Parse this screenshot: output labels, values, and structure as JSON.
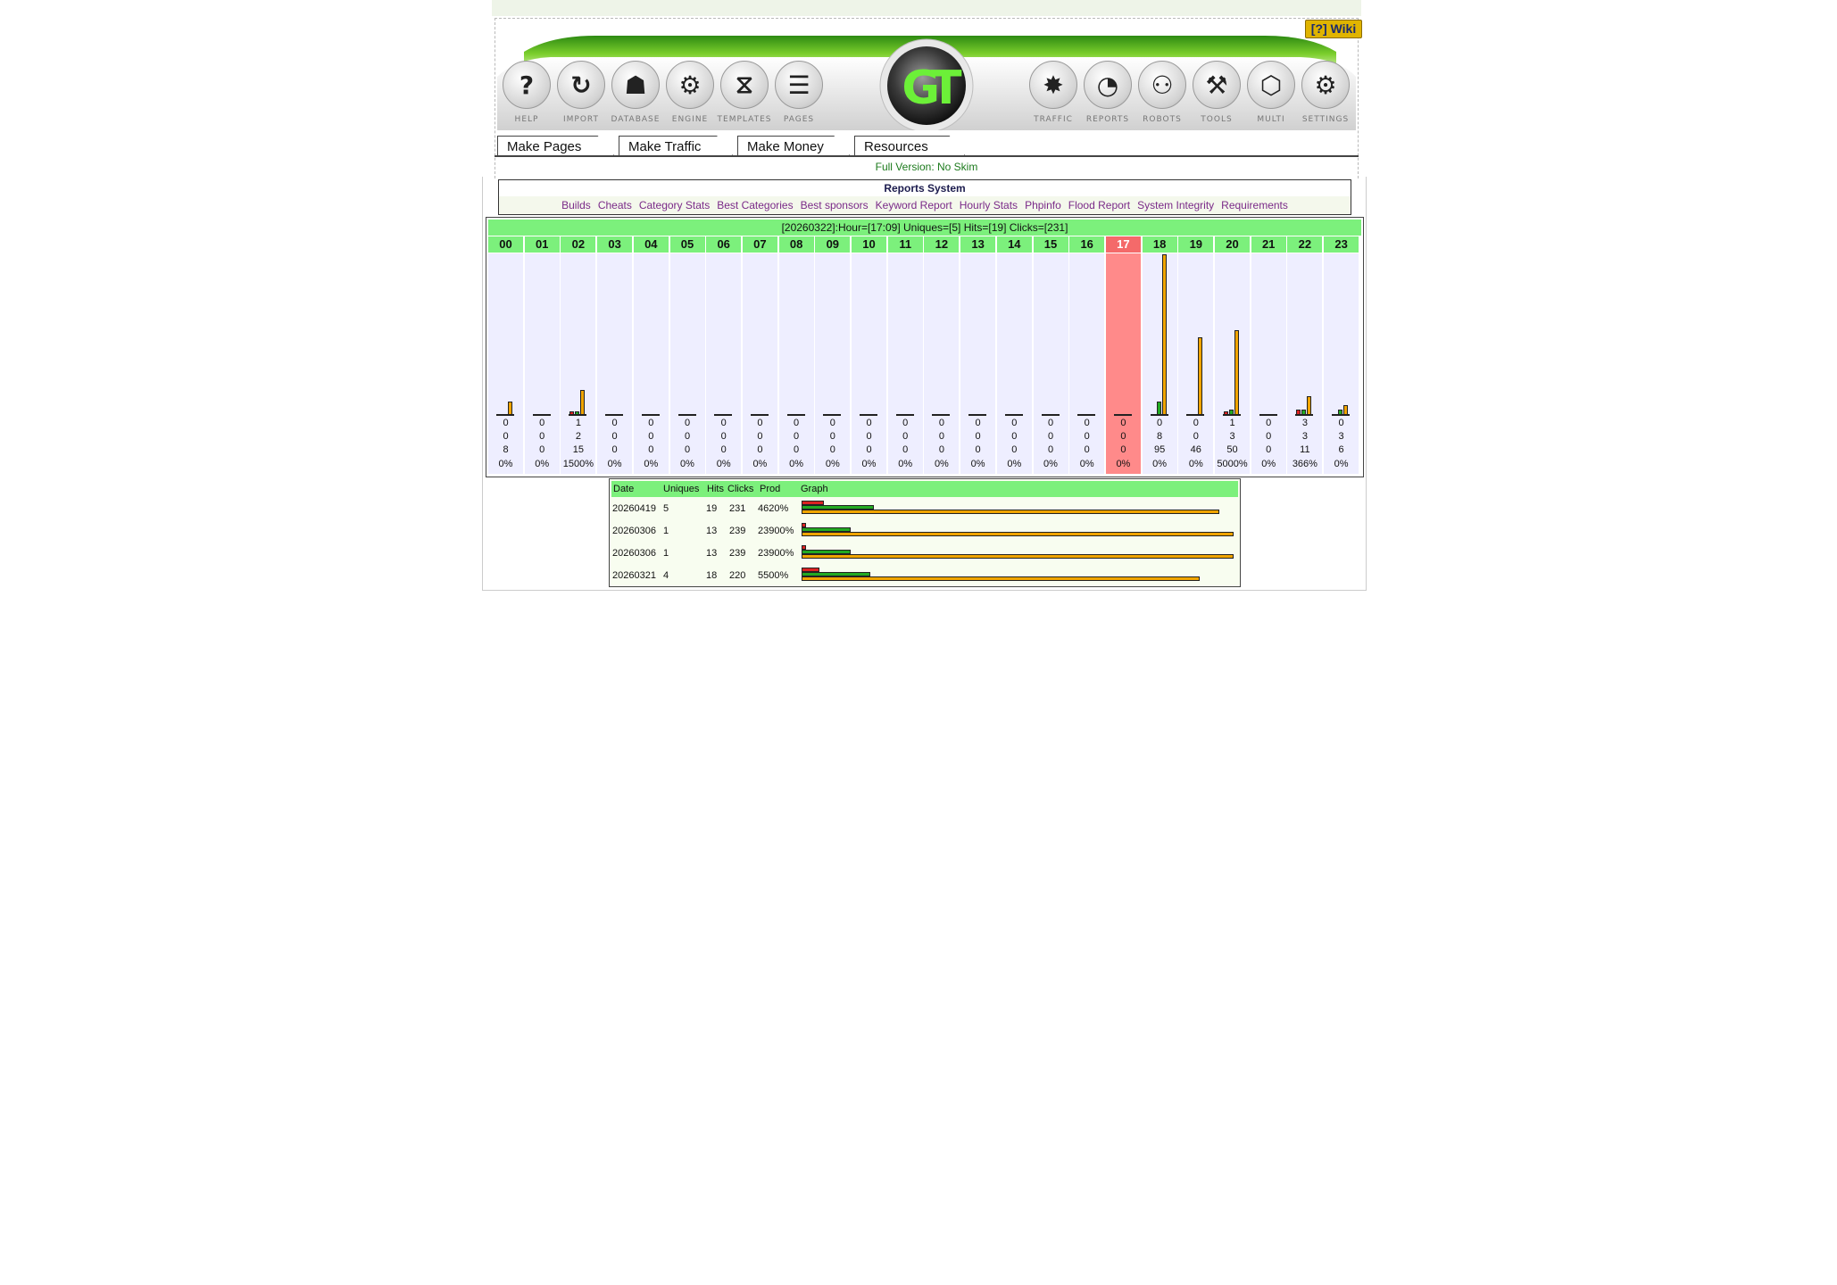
{
  "header": {
    "wiki_label": "[?] Wiki",
    "left_icons": [
      {
        "label": "HELP",
        "icon": "help-icon"
      },
      {
        "label": "IMPORT",
        "icon": "import-icon"
      },
      {
        "label": "DATABASE",
        "icon": "database-icon"
      },
      {
        "label": "ENGINE",
        "icon": "engine-icon"
      },
      {
        "label": "TEMPLATES",
        "icon": "templates-icon"
      },
      {
        "label": "PAGES",
        "icon": "pages-icon"
      }
    ],
    "right_icons": [
      {
        "label": "TRAFFIC",
        "icon": "traffic-icon"
      },
      {
        "label": "REPORTS",
        "icon": "reports-icon"
      },
      {
        "label": "ROBOTS",
        "icon": "robots-icon"
      },
      {
        "label": "TOOLS",
        "icon": "tools-icon"
      },
      {
        "label": "MULTI",
        "icon": "multi-icon"
      },
      {
        "label": "SETTINGS",
        "icon": "settings-icon"
      }
    ],
    "logo_text": "GT"
  },
  "tabs": [
    "Make Pages",
    "Make Traffic",
    "Make Money",
    "Resources"
  ],
  "version_text": "Full Version: No Skim",
  "reports": {
    "title": "Reports System",
    "links": [
      "Builds",
      "Cheats",
      "Category Stats",
      "Best Categories",
      "Best sponsors",
      "Keyword Report",
      "Hourly Stats",
      "Phpinfo",
      "Flood Report",
      "System Integrity",
      "Requirements"
    ]
  },
  "hourly": {
    "header": "[20260322]:Hour=[17:09] Uniques=[5] Hits=[19] Clicks=[231]",
    "active_hour": "17",
    "colors": {
      "uniques": "#dd2222",
      "hits": "#22aa22",
      "clicks": "#f0a400"
    },
    "hours": [
      {
        "hour": "00",
        "u": 0,
        "h": 0,
        "c": 8,
        "pct": "0%"
      },
      {
        "hour": "01",
        "u": 0,
        "h": 0,
        "c": 0,
        "pct": "0%"
      },
      {
        "hour": "02",
        "u": 1,
        "h": 2,
        "c": 15,
        "pct": "1500%"
      },
      {
        "hour": "03",
        "u": 0,
        "h": 0,
        "c": 0,
        "pct": "0%"
      },
      {
        "hour": "04",
        "u": 0,
        "h": 0,
        "c": 0,
        "pct": "0%"
      },
      {
        "hour": "05",
        "u": 0,
        "h": 0,
        "c": 0,
        "pct": "0%"
      },
      {
        "hour": "06",
        "u": 0,
        "h": 0,
        "c": 0,
        "pct": "0%"
      },
      {
        "hour": "07",
        "u": 0,
        "h": 0,
        "c": 0,
        "pct": "0%"
      },
      {
        "hour": "08",
        "u": 0,
        "h": 0,
        "c": 0,
        "pct": "0%"
      },
      {
        "hour": "09",
        "u": 0,
        "h": 0,
        "c": 0,
        "pct": "0%"
      },
      {
        "hour": "10",
        "u": 0,
        "h": 0,
        "c": 0,
        "pct": "0%"
      },
      {
        "hour": "11",
        "u": 0,
        "h": 0,
        "c": 0,
        "pct": "0%"
      },
      {
        "hour": "12",
        "u": 0,
        "h": 0,
        "c": 0,
        "pct": "0%"
      },
      {
        "hour": "13",
        "u": 0,
        "h": 0,
        "c": 0,
        "pct": "0%"
      },
      {
        "hour": "14",
        "u": 0,
        "h": 0,
        "c": 0,
        "pct": "0%"
      },
      {
        "hour": "15",
        "u": 0,
        "h": 0,
        "c": 0,
        "pct": "0%"
      },
      {
        "hour": "16",
        "u": 0,
        "h": 0,
        "c": 0,
        "pct": "0%"
      },
      {
        "hour": "17",
        "u": 0,
        "h": 0,
        "c": 0,
        "pct": "0%"
      },
      {
        "hour": "18",
        "u": 0,
        "h": 8,
        "c": 95,
        "pct": "0%"
      },
      {
        "hour": "19",
        "u": 0,
        "h": 0,
        "c": 46,
        "pct": "0%"
      },
      {
        "hour": "20",
        "u": 1,
        "h": 3,
        "c": 50,
        "pct": "5000%"
      },
      {
        "hour": "21",
        "u": 0,
        "h": 0,
        "c": 0,
        "pct": "0%"
      },
      {
        "hour": "22",
        "u": 3,
        "h": 3,
        "c": 11,
        "pct": "366%"
      },
      {
        "hour": "23",
        "u": 0,
        "h": 3,
        "c": 6,
        "pct": "0%"
      }
    ]
  },
  "daily": {
    "headers": [
      "Date",
      "Uniques",
      "Hits",
      "Clicks",
      "Prod",
      "Graph"
    ],
    "rows": [
      {
        "date": "20260419",
        "uniques": 5,
        "hits": 19,
        "clicks": 231,
        "prod": "4620%"
      },
      {
        "date": "20260306",
        "uniques": 1,
        "hits": 13,
        "clicks": 239,
        "prod": "23900%"
      },
      {
        "date": "20260306",
        "uniques": 1,
        "hits": 13,
        "clicks": 239,
        "prod": "23900%"
      },
      {
        "date": "20260321",
        "uniques": 4,
        "hits": 18,
        "clicks": 220,
        "prod": "5500%"
      }
    ]
  }
}
